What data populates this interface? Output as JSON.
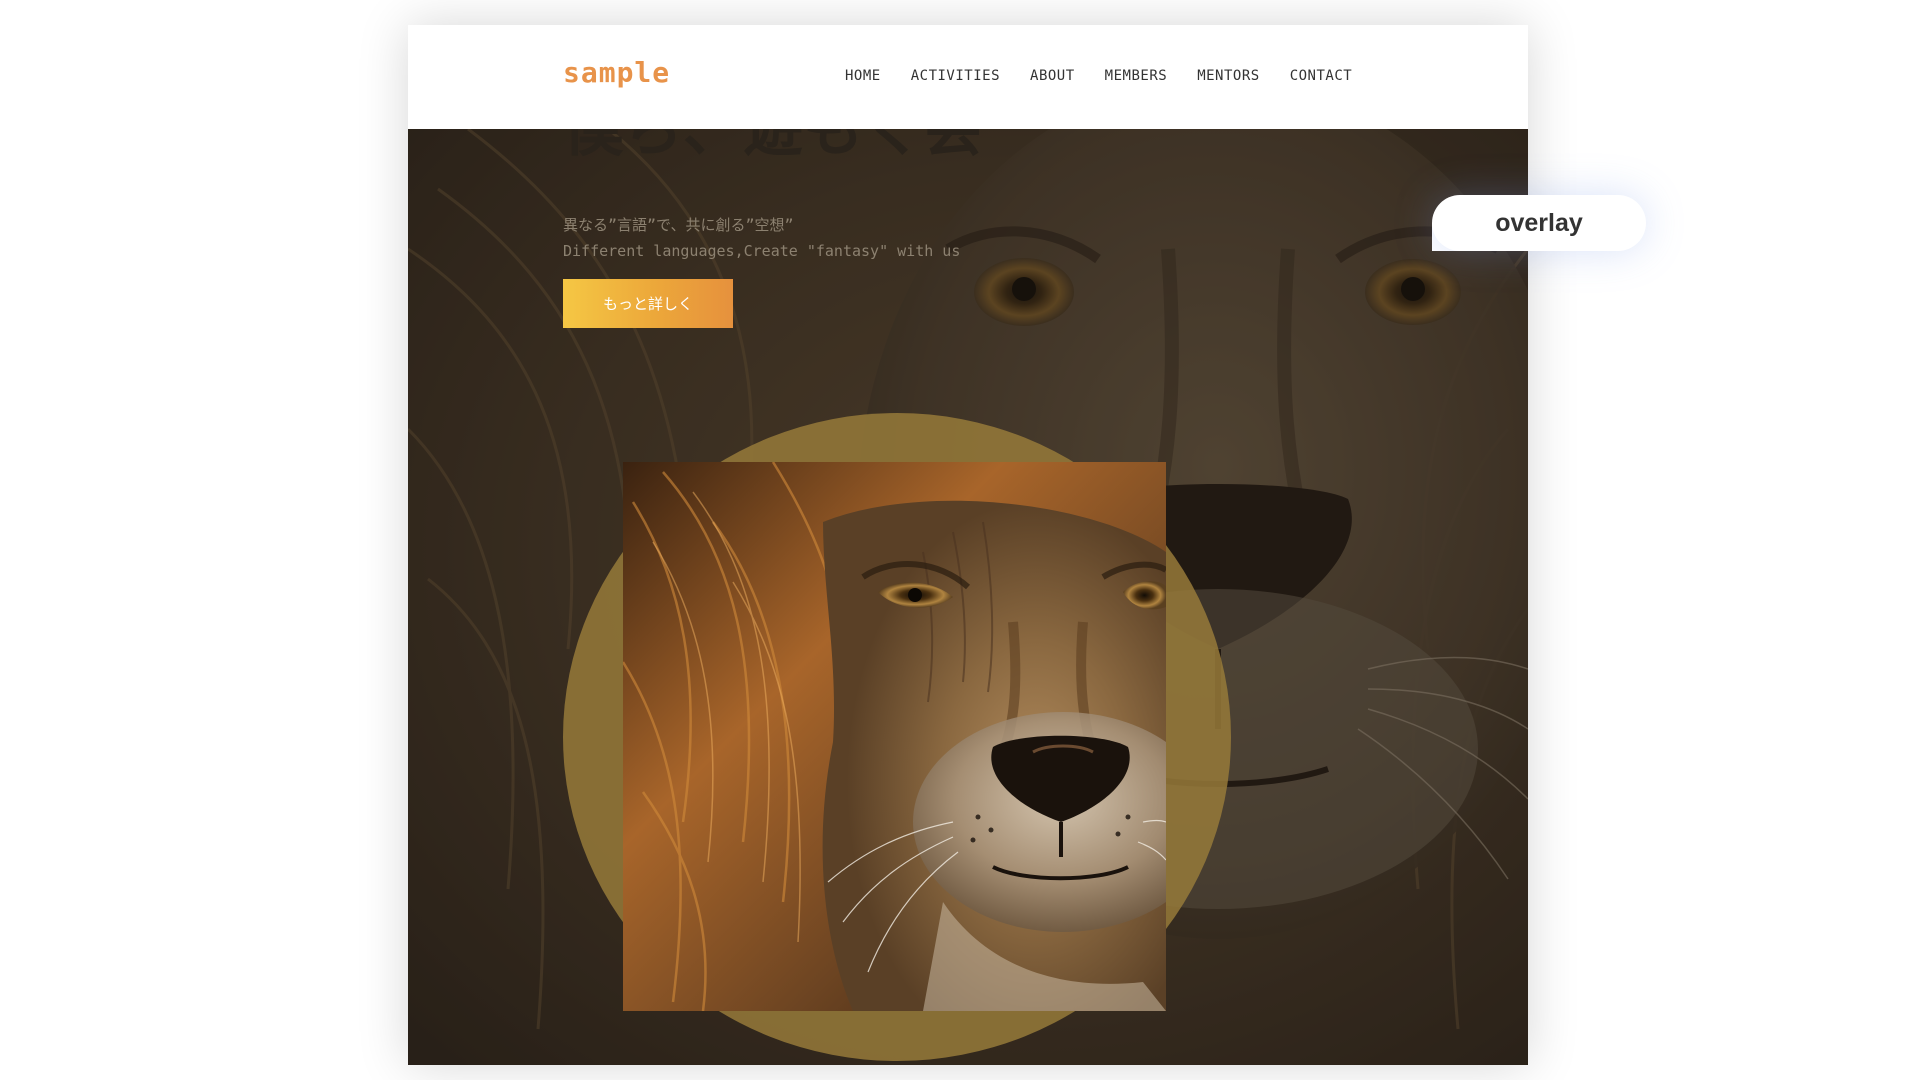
{
  "header": {
    "logo": "sample",
    "nav": [
      "HOME",
      "ACTIVITIES",
      "ABOUT",
      "MEMBERS",
      "MENTORS",
      "CONTACT"
    ]
  },
  "hero": {
    "title": "僕ら、遊もく会",
    "subtitle_ja": "異なる”言語”で、共に創る”空想”",
    "subtitle_en": "Different languages,Create \"fantasy\" with us",
    "cta_label": "もっと詳しく",
    "background_image": "lion-face-icon",
    "feature_image": "lion-portrait-icon"
  },
  "overlay": {
    "label": "overlay"
  },
  "colors": {
    "logo": "#e8934a",
    "cta_start": "#f5c744",
    "cta_end": "#e6913d",
    "blob": "#967a3a"
  }
}
